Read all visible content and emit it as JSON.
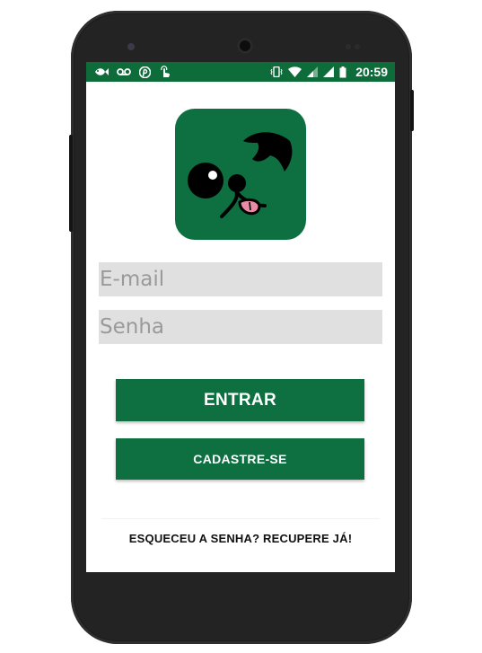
{
  "status_bar": {
    "time": "20:59",
    "notification_icons": [
      "fish-icon",
      "voicemail-icon",
      "pinterest-icon",
      "touch-icon"
    ],
    "system_icons": [
      "vibrate-icon",
      "wifi-icon",
      "signal-icon",
      "signal-icon-2",
      "battery-icon"
    ]
  },
  "logo": {
    "name": "dog-face-logo"
  },
  "form": {
    "email_placeholder": "E-mail",
    "password_placeholder": "Senha",
    "email_value": "",
    "password_value": ""
  },
  "buttons": {
    "login_label": "ENTRAR",
    "signup_label": "CADASTRE-SE"
  },
  "forgot_link": "ESQUECEU A SENHA? RECUPERE JÁ!",
  "colors": {
    "brand_green": "#0e7040",
    "status_bar": "#0e6b3a",
    "field_bg": "#e0e0e0",
    "tongue": "#e98aa6"
  }
}
